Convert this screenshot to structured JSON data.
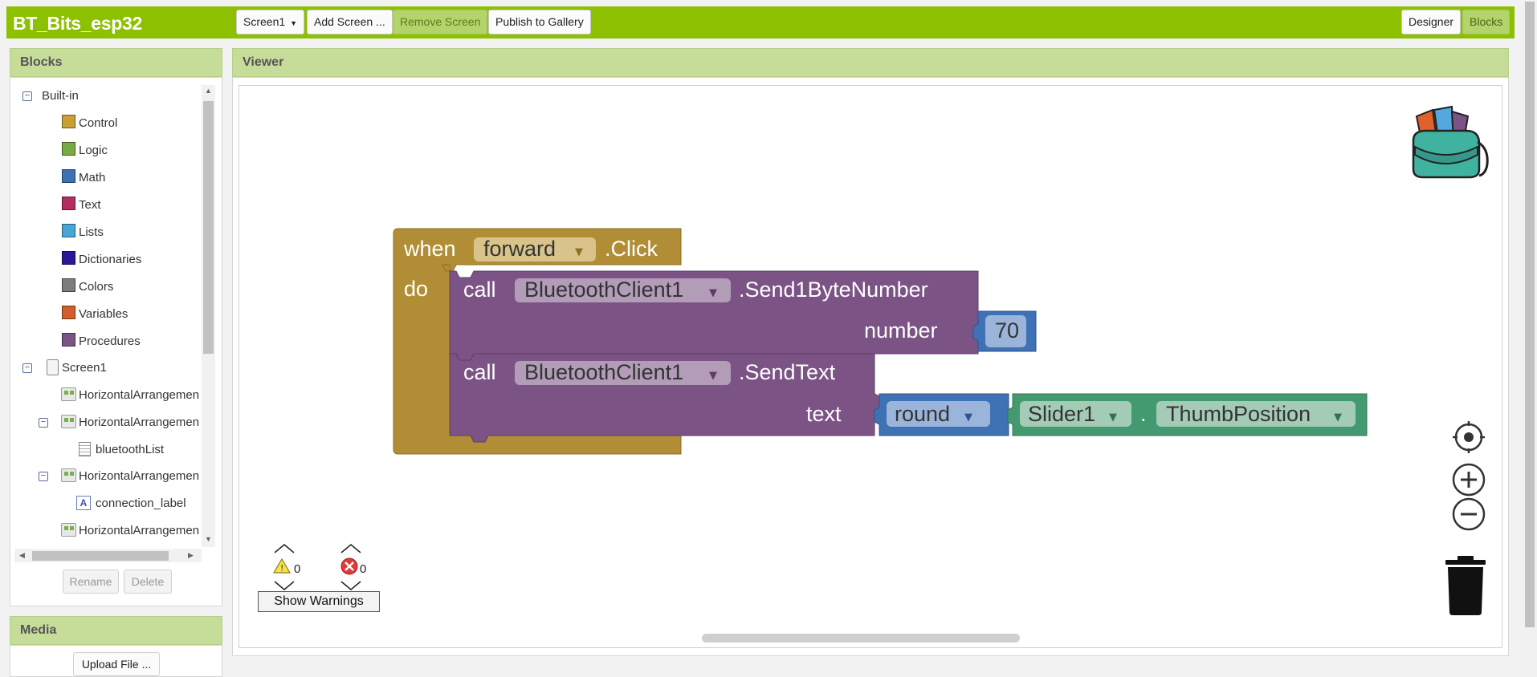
{
  "app": {
    "title": "BT_Bits_esp32"
  },
  "toolbar": {
    "screen_select": "Screen1",
    "add_screen": "Add Screen ...",
    "remove_screen": "Remove Screen",
    "publish": "Publish to Gallery",
    "designer": "Designer",
    "blocks": "Blocks"
  },
  "blocks_panel": {
    "title": "Blocks",
    "builtin_label": "Built-in",
    "builtin": [
      {
        "label": "Control",
        "color": "#c8a036"
      },
      {
        "label": "Logic",
        "color": "#77ab41"
      },
      {
        "label": "Math",
        "color": "#3f71b5"
      },
      {
        "label": "Text",
        "color": "#b32d5e"
      },
      {
        "label": "Lists",
        "color": "#49a6d4"
      },
      {
        "label": "Dictionaries",
        "color": "#2d1799"
      },
      {
        "label": "Colors",
        "color": "#7d7d7d"
      },
      {
        "label": "Variables",
        "color": "#d05f2d"
      },
      {
        "label": "Procedures",
        "color": "#7c5385"
      }
    ],
    "screen_label": "Screen1",
    "components": [
      {
        "label": "HorizontalArrangemen"
      },
      {
        "label": "HorizontalArrangemen"
      },
      {
        "label": "bluetoothList"
      },
      {
        "label": "HorizontalArrangemen"
      },
      {
        "label": "connection_label"
      },
      {
        "label": "HorizontalArrangemen"
      }
    ],
    "rename": "Rename",
    "delete": "Delete"
  },
  "media_panel": {
    "title": "Media",
    "upload": "Upload File ..."
  },
  "viewer": {
    "title": "Viewer"
  },
  "blocks": {
    "event": {
      "when": "when",
      "component": "forward",
      "event": ".Click",
      "do": "do"
    },
    "call1": {
      "call": "call",
      "component": "BluetoothClient1",
      "method": ".Send1ByteNumber",
      "arg": "number",
      "value": "70"
    },
    "call2": {
      "call": "call",
      "component": "BluetoothClient1",
      "method": ".SendText",
      "arg": "text",
      "math_op": "round",
      "slider": "Slider1",
      "dot": ".",
      "property": "ThumbPosition"
    }
  },
  "warnings": {
    "warning_count": "0",
    "error_count": "0",
    "show_warnings": "Show Warnings"
  },
  "colors": {
    "accent": "#8dc100",
    "panel_header": "#c6dd9a",
    "control_block": "#b18e35",
    "component_block": "#7c5385",
    "math_block": "#3f71b5",
    "slider_block": "#439970"
  }
}
